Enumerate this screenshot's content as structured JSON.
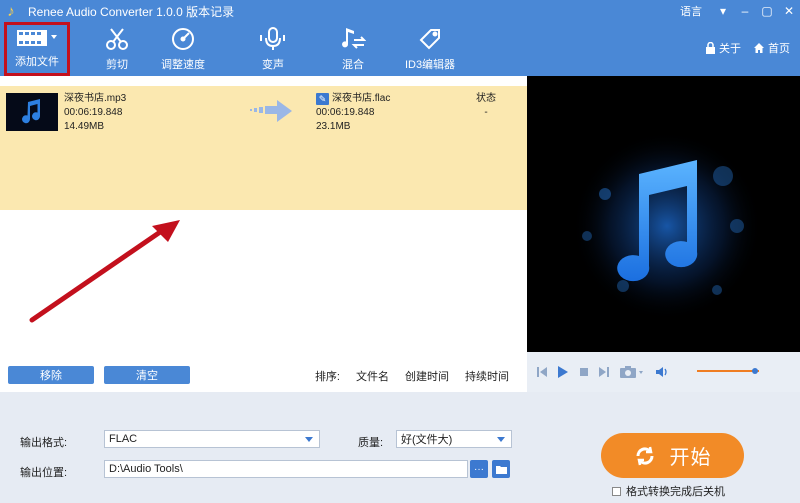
{
  "window": {
    "title": "Renee Audio Converter 1.0.0 版本记录",
    "language": "语言",
    "controls": [
      "–",
      "▢",
      "✕"
    ]
  },
  "toolbar": {
    "add_file": "添加文件",
    "cut": "剪切",
    "speed": "调整速度",
    "voice": "变声",
    "mix": "混合",
    "id3": "ID3编辑器",
    "about": "关于",
    "home": "首页"
  },
  "file": {
    "source": {
      "name": "深夜书店.mp3",
      "duration": "00:06:19.848",
      "size": "14.49MB"
    },
    "output": {
      "name": "深夜书店.flac",
      "duration": "00:06:19.848",
      "size": "23.1MB"
    },
    "status_header": "状态",
    "status_value": "-"
  },
  "list_actions": {
    "remove": "移除",
    "clear": "清空"
  },
  "sort": {
    "label": "排序:",
    "by_name": "文件名",
    "by_created": "创建时间",
    "by_duration": "持续时间"
  },
  "player": {
    "volume_level": 0.93
  },
  "output": {
    "format_label": "输出格式:",
    "format_value": "FLAC",
    "quality_label": "质量:",
    "quality_value": "好(文件大)",
    "location_label": "输出位置:",
    "location_value": "D:\\Audio Tools\\",
    "browse_label": "···"
  },
  "start": {
    "label": "开始",
    "shutdown_label": "格式转换完成后关机"
  },
  "colors": {
    "titlebar": "#4a88d6",
    "row_highlight": "#fbe8b0",
    "start": "#f28b27",
    "annotation": "#c3101d"
  }
}
